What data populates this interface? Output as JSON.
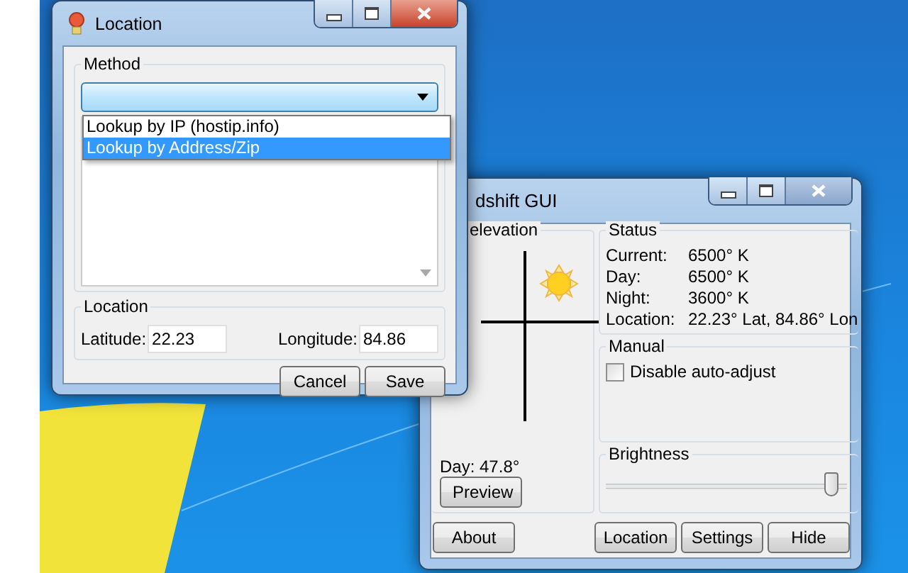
{
  "location_window": {
    "title": "Location",
    "method": {
      "legend": "Method",
      "dropdown_items": [
        {
          "label": "Lookup by IP (hostip.info)",
          "selected": false
        },
        {
          "label": "Lookup by Address/Zip",
          "selected": true
        }
      ]
    },
    "location": {
      "legend": "Location",
      "latitude_label": "Latitude:",
      "latitude": "22.23",
      "longitude_label": "Longitude:",
      "longitude": "84.86"
    },
    "buttons": [
      "Cancel",
      "Save"
    ]
  },
  "redshift_window": {
    "title": "dshift GUI",
    "elevation": {
      "legend": "elevation",
      "day_label": "Day: 47.8°",
      "preview_button": "Preview"
    },
    "status": {
      "legend": "Status",
      "rows": [
        {
          "label": "Current:",
          "value": "6500° K"
        },
        {
          "label": "Day:",
          "value": "6500° K"
        },
        {
          "label": "Night:",
          "value": "3600° K"
        },
        {
          "label": "Location:",
          "value": "22.23° Lat, 84.86° Lon"
        }
      ]
    },
    "manual": {
      "legend": "Manual",
      "checkbox": {
        "label": "Disable auto-adjust",
        "checked": false
      }
    },
    "brightness": {
      "legend": "Brightness",
      "level": 0.97
    },
    "buttons": [
      "About",
      "Location",
      "Settings",
      "Hide"
    ]
  }
}
